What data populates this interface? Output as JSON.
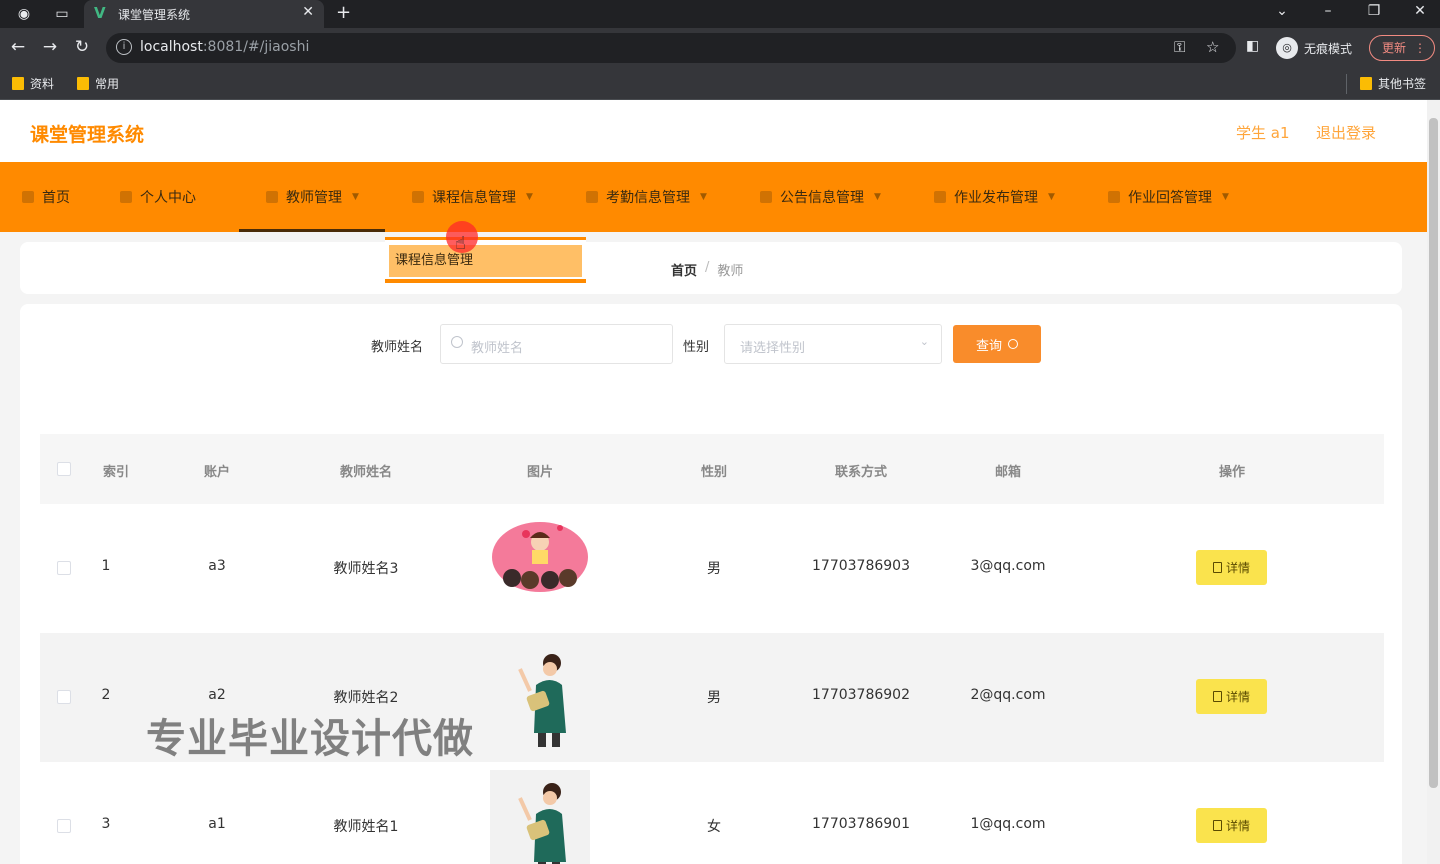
{
  "browser": {
    "tab_title": "课堂管理系统",
    "url_host": "localhost",
    "url_rest": ":8081/#/jiaoshi",
    "incognito_label": "无痕模式",
    "update_label": "更新",
    "bookmarks": [
      "资料",
      "常用"
    ],
    "other_bookmarks": "其他书签"
  },
  "header": {
    "brand": "课堂管理系统",
    "user": "学生 a1",
    "logout": "退出登录"
  },
  "nav": {
    "items": [
      "首页",
      "个人中心",
      "教师管理",
      "课程信息管理",
      "考勤信息管理",
      "公告信息管理",
      "作业发布管理",
      "作业回答管理"
    ],
    "dropdown_item": "课程信息管理"
  },
  "breadcrumb": {
    "home": "首页",
    "sep": "/",
    "current": "教师"
  },
  "search": {
    "name_label": "教师姓名",
    "name_placeholder": "教师姓名",
    "gender_label": "性别",
    "gender_placeholder": "请选择性别",
    "query_button": "查询"
  },
  "table": {
    "headers": [
      "索引",
      "账户",
      "教师姓名",
      "图片",
      "性别",
      "联系方式",
      "邮箱",
      "操作"
    ],
    "detail_label": "详情",
    "rows": [
      {
        "index": "1",
        "account": "a3",
        "name": "教师姓名3",
        "gender": "男",
        "phone": "17703786903",
        "email": "3@qq.com"
      },
      {
        "index": "2",
        "account": "a2",
        "name": "教师姓名2",
        "gender": "男",
        "phone": "17703786902",
        "email": "2@qq.com"
      },
      {
        "index": "3",
        "account": "a1",
        "name": "教师姓名1",
        "gender": "女",
        "phone": "17703786901",
        "email": "1@qq.com"
      }
    ]
  },
  "watermark": "专业毕业设计代做",
  "colors": {
    "primary": "#ff8a00",
    "query_button": "#f98c2b",
    "detail_button": "#fae34d"
  }
}
